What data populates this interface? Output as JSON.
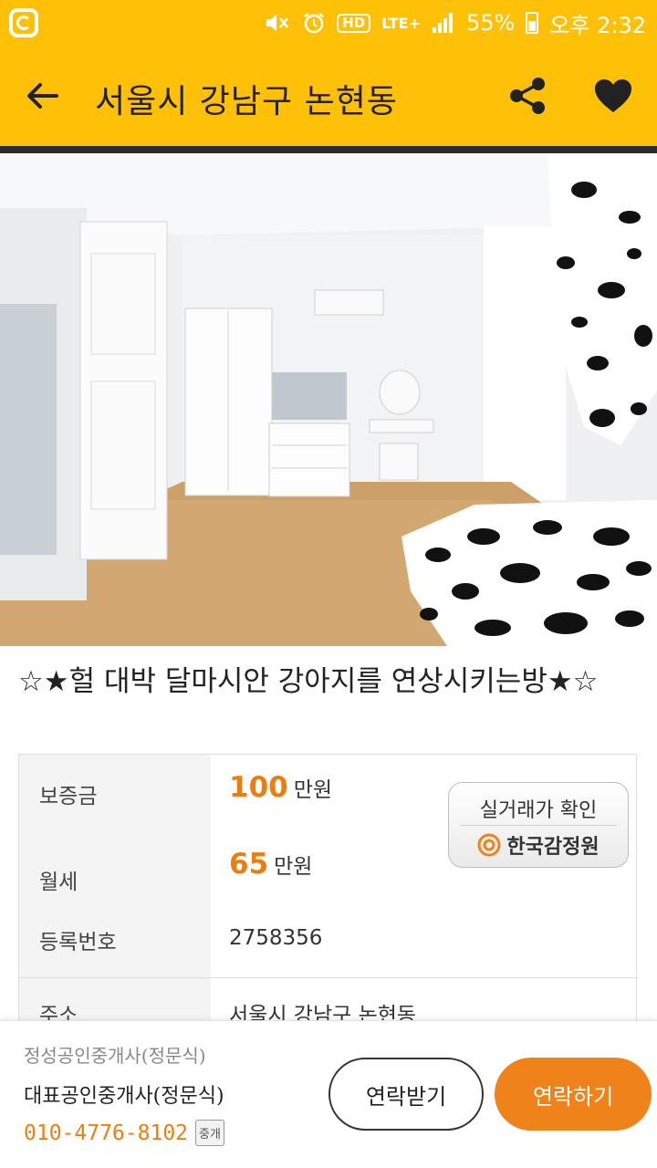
{
  "status_bar": {
    "battery": "55%",
    "time": "오후 2:32",
    "hd": "HD",
    "network": "LTE+"
  },
  "header": {
    "title": "서울시 강남구 논현동",
    "back_icon": "arrow-back-icon",
    "share_icon": "share-icon",
    "favorite_icon": "heart-icon"
  },
  "listing": {
    "title": "☆★헐 대박 달마시안 강아지를 연상시키는방★☆"
  },
  "info": {
    "deposit_label": "보증금",
    "deposit_value": "100",
    "deposit_unit": "만원",
    "monthly_label": "월세",
    "monthly_value": "65",
    "monthly_unit": "만원",
    "reg_label": "등록번호",
    "reg_value": "2758356",
    "address_label": "주소",
    "address_value": "서울시 강남구 논현동",
    "verify_line1": "실거래가 확인",
    "verify_line2": "한국감정원"
  },
  "agent": {
    "agency": "정성공인중개사(정문식)",
    "representative": "대표공인중개사(정문식)",
    "phone": "010-4776-8102",
    "tag": "중개"
  },
  "actions": {
    "receive_contact": "연락받기",
    "contact": "연락하기"
  },
  "colors": {
    "brand": "#ffc107",
    "accent": "#ee7d11"
  }
}
